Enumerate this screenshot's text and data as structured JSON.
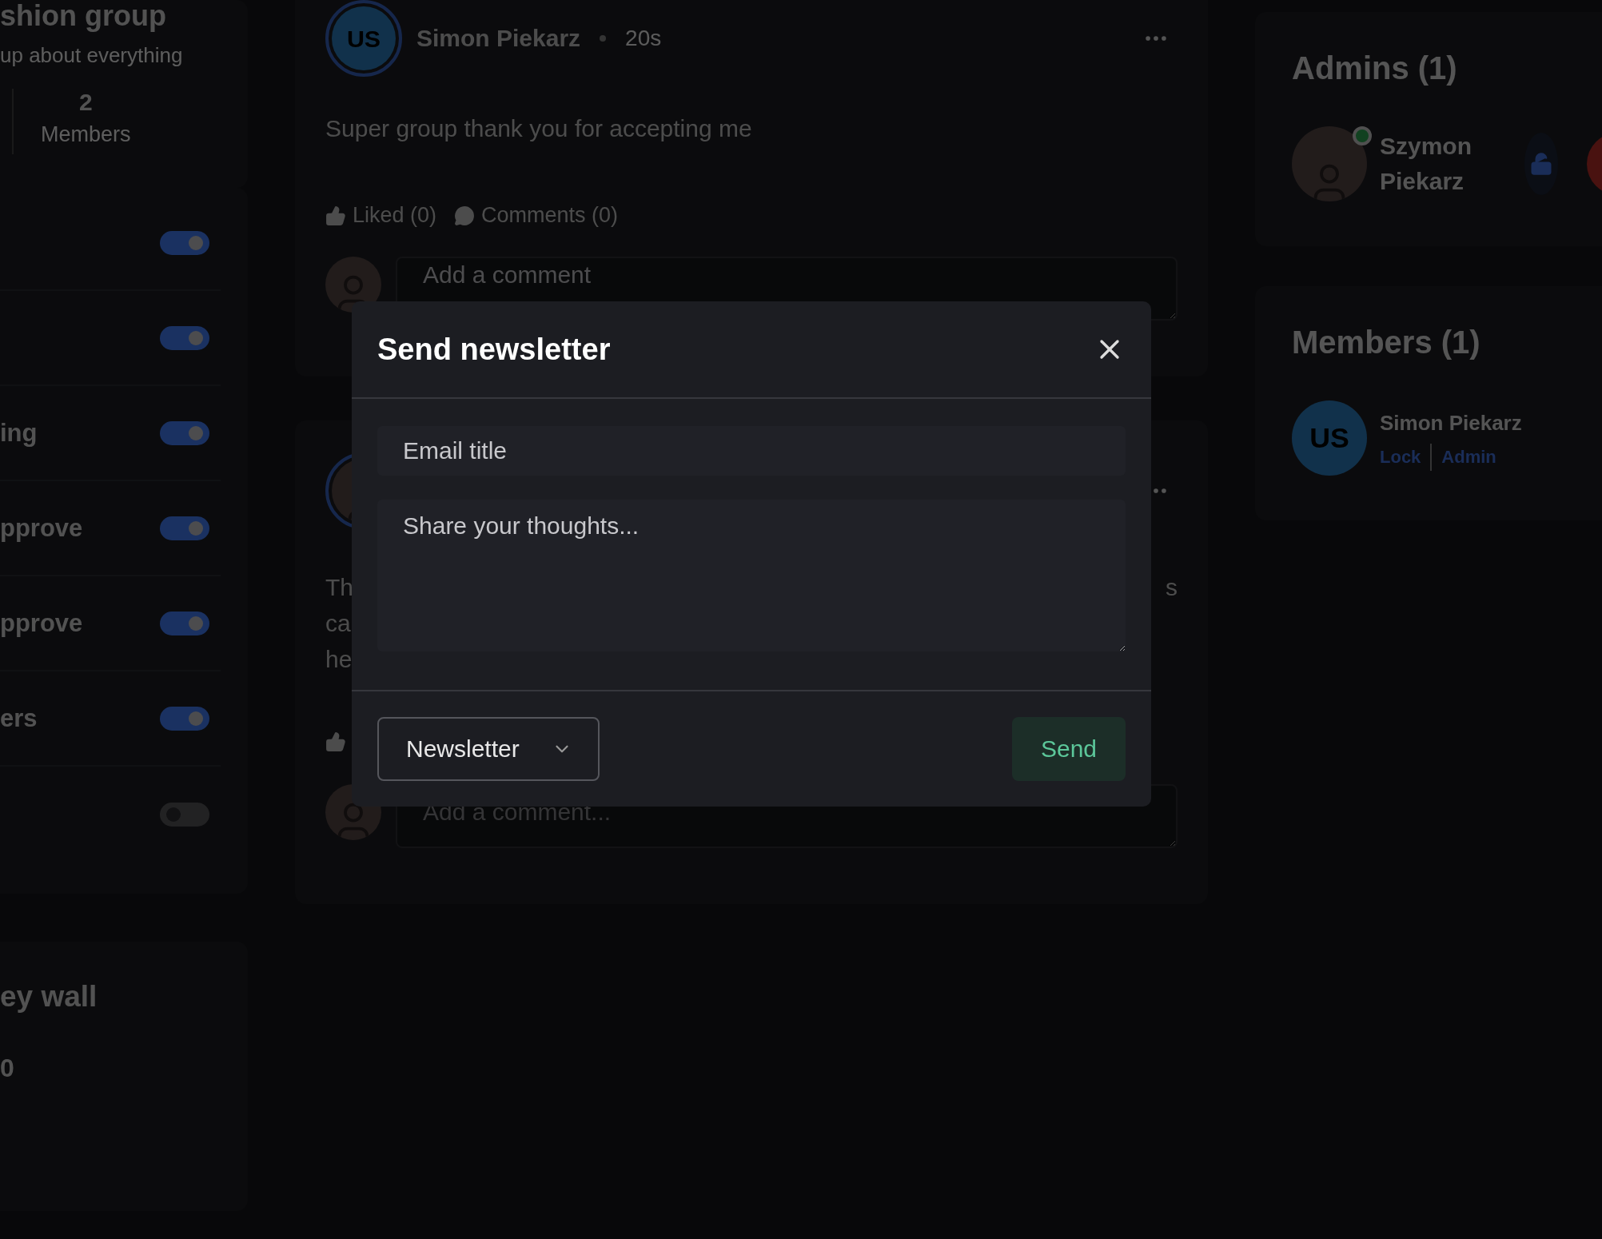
{
  "group": {
    "title": "shion group",
    "subtitle": "up about everything",
    "stats": [
      {
        "value": "2",
        "label": "Members"
      }
    ]
  },
  "settings": [
    {
      "on": true
    },
    {
      "on": true
    },
    {
      "label": "ing",
      "on": true
    },
    {
      "label": "pprove",
      "on": true
    },
    {
      "label": "pprove",
      "on": true
    },
    {
      "label": "ers",
      "on": true
    },
    {
      "on": false
    }
  ],
  "wall": {
    "title": "ey wall",
    "value": "0"
  },
  "posts": [
    {
      "initials": "US",
      "author": "Simon Piekarz",
      "time": "20s",
      "text": "Super group thank you for accepting me",
      "liked": "Liked (0)",
      "comments": "Comments (0)",
      "comment_placeholder": "Add a comment"
    },
    {
      "text_left": [
        "Th",
        "ca",
        "he"
      ],
      "text_right": [
        "s"
      ],
      "comment_placeholder": "Add a comment..."
    }
  ],
  "admins": {
    "title": "Admins (1)",
    "people": [
      {
        "name": "Szymon Piekarz",
        "online": true
      }
    ]
  },
  "members": {
    "title": "Members (1)",
    "people": [
      {
        "initials": "US",
        "name": "Simon Piekarz",
        "actions": [
          "Lock",
          "Admin"
        ]
      }
    ]
  },
  "modal": {
    "title": "Send newsletter",
    "email_title_placeholder": "Email title",
    "body_placeholder": "Share your thoughts...",
    "select": "Newsletter",
    "send": "Send"
  }
}
